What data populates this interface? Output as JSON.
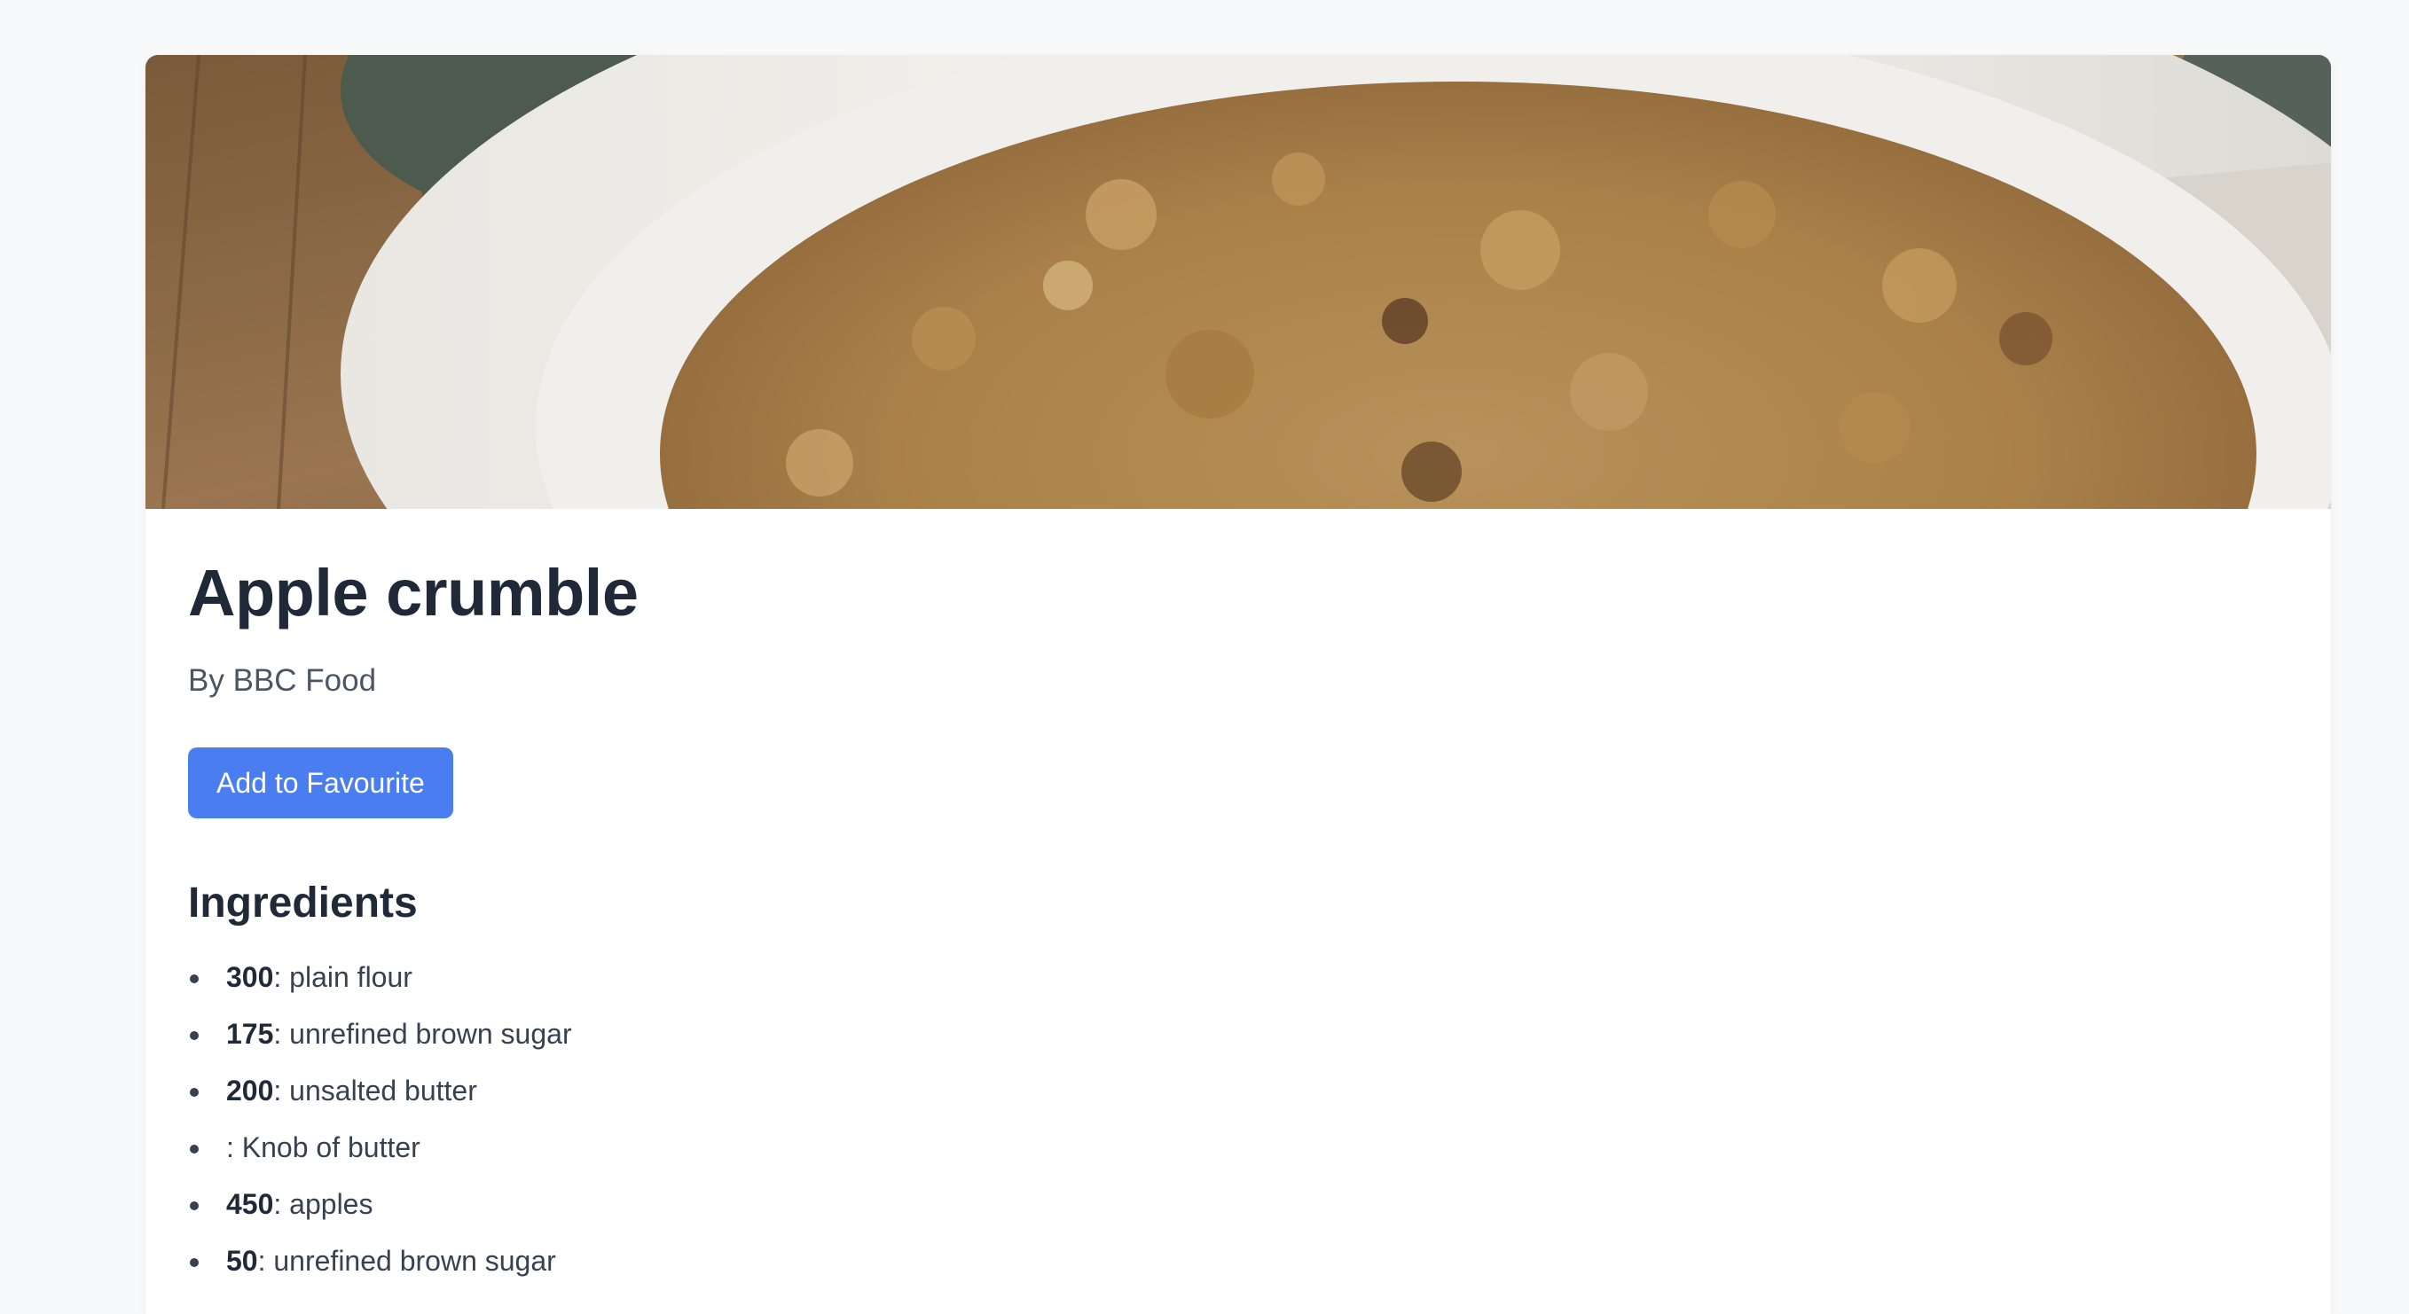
{
  "recipe": {
    "title": "Apple crumble",
    "author": "By BBC Food",
    "favourite_button_label": "Add to Favourite",
    "hero_image_alt": "Apple crumble in a white baking dish"
  },
  "ingredients": {
    "heading": "Ingredients",
    "items": [
      {
        "qty": "300",
        "sep": ": ",
        "name": "plain flour"
      },
      {
        "qty": "175",
        "sep": ": ",
        "name": "unrefined brown sugar"
      },
      {
        "qty": "200",
        "sep": ": ",
        "name": "unsalted butter"
      },
      {
        "qty": "",
        "sep": ": ",
        "name": "Knob of butter"
      },
      {
        "qty": "450",
        "sep": ": ",
        "name": "apples"
      },
      {
        "qty": "50",
        "sep": ": ",
        "name": "unrefined brown sugar"
      }
    ]
  },
  "colors": {
    "page_background": "#f8f9fb",
    "card_background": "#ffffff",
    "button_accent": "#4a7ef0",
    "heading_text": "#1f2937",
    "body_text": "#374151"
  }
}
